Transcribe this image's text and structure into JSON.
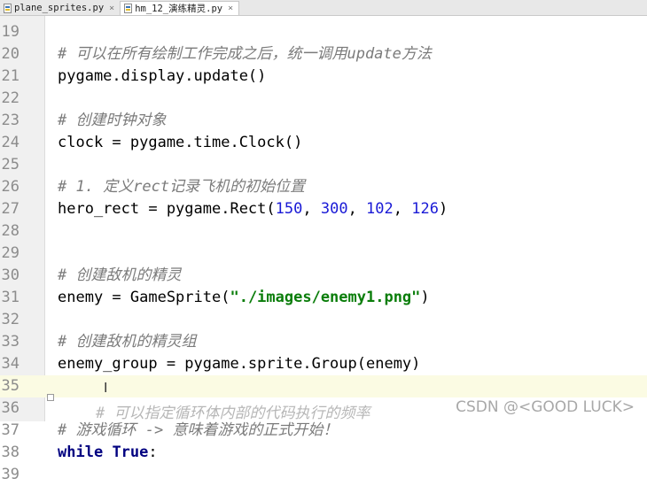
{
  "tabs": [
    {
      "label": "plane_sprites.py",
      "close": "×",
      "active": false
    },
    {
      "label": "hm_12_演练精灵.py",
      "close": "×",
      "active": true
    }
  ],
  "lines": [
    {
      "n": "19",
      "tokens": []
    },
    {
      "n": "20",
      "tokens": [
        {
          "t": "# 可以在所有绘制工作完成之后，统一调用update方法",
          "c": "cmt"
        }
      ]
    },
    {
      "n": "21",
      "tokens": [
        {
          "t": "pygame.display.update()",
          "c": ""
        }
      ]
    },
    {
      "n": "22",
      "tokens": []
    },
    {
      "n": "23",
      "tokens": [
        {
          "t": "# 创建时钟对象",
          "c": "cmt"
        }
      ]
    },
    {
      "n": "24",
      "tokens": [
        {
          "t": "clock = pygame.time.Clock()",
          "c": ""
        }
      ]
    },
    {
      "n": "25",
      "tokens": []
    },
    {
      "n": "26",
      "tokens": [
        {
          "t": "# 1. 定义rect记录飞机的初始位置",
          "c": "cmt"
        }
      ]
    },
    {
      "n": "27",
      "tokens": [
        {
          "t": "hero_rect = pygame.Rect(",
          "c": ""
        },
        {
          "t": "150",
          "c": "num"
        },
        {
          "t": ", ",
          "c": ""
        },
        {
          "t": "300",
          "c": "num"
        },
        {
          "t": ", ",
          "c": ""
        },
        {
          "t": "102",
          "c": "num"
        },
        {
          "t": ", ",
          "c": ""
        },
        {
          "t": "126",
          "c": "num"
        },
        {
          "t": ")",
          "c": ""
        }
      ]
    },
    {
      "n": "28",
      "tokens": []
    },
    {
      "n": "29",
      "tokens": []
    },
    {
      "n": "30",
      "tokens": [
        {
          "t": "# 创建敌机的精灵",
          "c": "cmt"
        }
      ]
    },
    {
      "n": "31",
      "tokens": [
        {
          "t": "enemy = GameSprite(",
          "c": ""
        },
        {
          "t": "\"./images/enemy1.png\"",
          "c": "str"
        },
        {
          "t": ")",
          "c": ""
        }
      ]
    },
    {
      "n": "32",
      "tokens": []
    },
    {
      "n": "33",
      "tokens": [
        {
          "t": "# 创建敌机的精灵组",
          "c": "cmt"
        }
      ]
    },
    {
      "n": "34",
      "tokens": [
        {
          "t": "enemy_group = pygame.sprite.Group(enemy)",
          "c": ""
        }
      ]
    },
    {
      "n": "35",
      "tokens": [],
      "current": true
    },
    {
      "n": "36",
      "tokens": []
    },
    {
      "n": "37",
      "tokens": [
        {
          "t": "# 游戏循环 -> 意味着游戏的正式开始！",
          "c": "cmt"
        }
      ]
    },
    {
      "n": "38",
      "tokens": [
        {
          "t": "while",
          "c": "kw"
        },
        {
          "t": " ",
          "c": ""
        },
        {
          "t": "True",
          "c": "kw"
        },
        {
          "t": ":",
          "c": ""
        }
      ]
    },
    {
      "n": "39",
      "tokens": []
    }
  ],
  "caret_glyph": "I",
  "partial_bottom_comment": "# 可以指定循环体内部的代码执行的频率",
  "watermark": "CSDN @<GOOD LUCK>"
}
